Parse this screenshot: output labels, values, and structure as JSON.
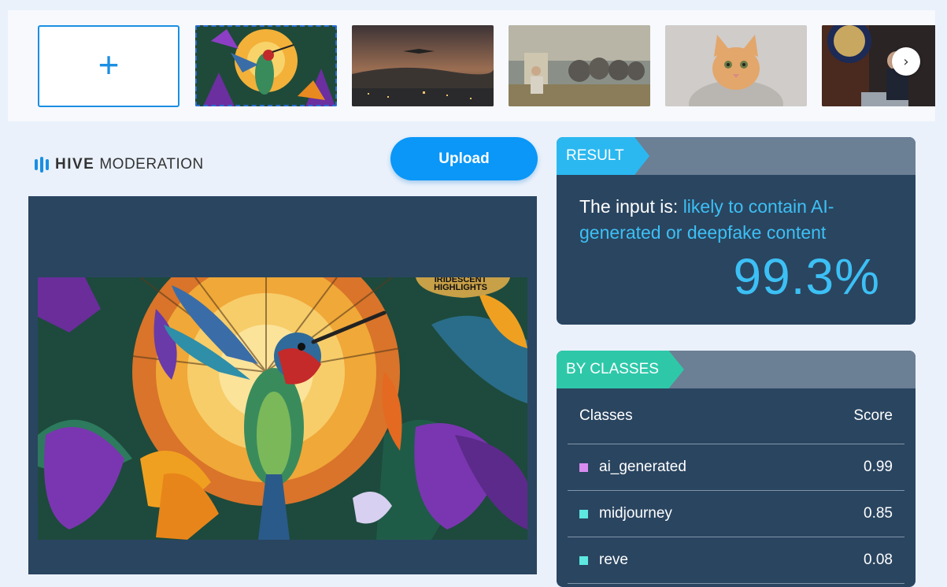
{
  "gallery": {
    "add_label": "+",
    "next_label": "›",
    "thumbnails": [
      {
        "name": "hummingbird-thumbnail",
        "selected": true
      },
      {
        "name": "city-night-thumbnail",
        "selected": false
      },
      {
        "name": "elephants-painting-thumbnail",
        "selected": false
      },
      {
        "name": "cat-hoodie-thumbnail",
        "selected": false
      },
      {
        "name": "press-podium-thumbnail",
        "selected": false
      }
    ]
  },
  "logo": {
    "hive": "HIVE",
    "moderation": "MODERATION"
  },
  "upload_label": "Upload",
  "preview": {
    "badge_line1": "IRIDESCENT",
    "badge_line2": "HIGHLIGHTS"
  },
  "result": {
    "tab_label": "RESULT",
    "prefix": "The input is: ",
    "verdict": "likely to contain AI-generated or deepfake content",
    "percent": "99.3%"
  },
  "by_classes": {
    "tab_label": "BY CLASSES",
    "col_class": "Classes",
    "col_score": "Score",
    "rows": [
      {
        "label": "ai_generated",
        "score": "0.99",
        "color": "#d98cf0"
      },
      {
        "label": "midjourney",
        "score": "0.85",
        "color": "#5ee8e0"
      },
      {
        "label": "reve",
        "score": "0.08",
        "color": "#5ee8e0"
      }
    ]
  },
  "colors": {
    "accent": "#0a97f7",
    "result_tab": "#2bb8f0",
    "classes_tab": "#2ec8a9",
    "panel": "#2a4560"
  }
}
